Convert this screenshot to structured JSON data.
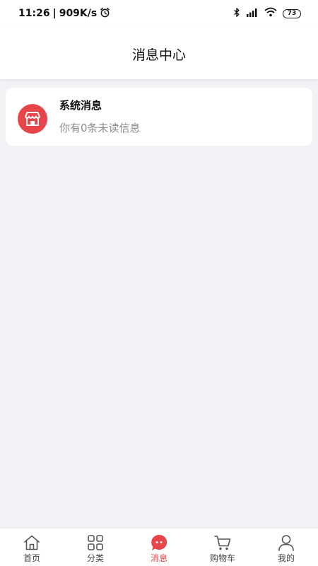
{
  "status_bar": {
    "time": "11:26",
    "speed": "909K/s",
    "battery": "73"
  },
  "header": {
    "title": "消息中心"
  },
  "messages": [
    {
      "title": "系统消息",
      "subtitle": "你有0条未读信息",
      "icon": "store-icon"
    }
  ],
  "tabs": [
    {
      "label": "首页",
      "icon": "home-icon",
      "active": false
    },
    {
      "label": "分类",
      "icon": "grid-icon",
      "active": false
    },
    {
      "label": "消息",
      "icon": "message-icon",
      "active": true
    },
    {
      "label": "购物车",
      "icon": "cart-icon",
      "active": false
    },
    {
      "label": "我的",
      "icon": "user-icon",
      "active": false
    }
  ],
  "colors": {
    "accent": "#e8454a",
    "background": "#f2f1f5",
    "card": "#ffffff",
    "muted_text": "#8c8c8c"
  }
}
